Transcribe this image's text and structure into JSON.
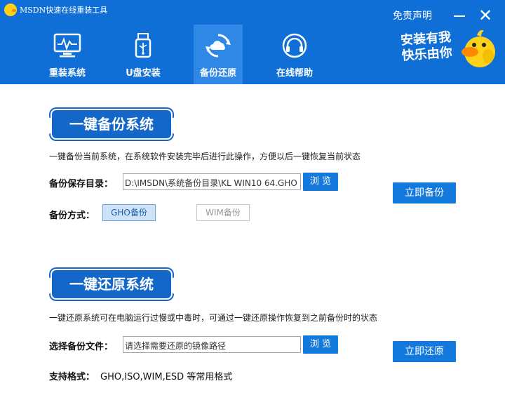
{
  "window": {
    "title": "MSDN快速在线重装工具",
    "disclaimer": "免责声明",
    "minimize_icon": "minimize-icon",
    "close_symbol": "✕"
  },
  "nav": {
    "items": [
      {
        "label": "重装系统",
        "icon": "monitor-icon",
        "active": false
      },
      {
        "label": "U盘安装",
        "icon": "usb-icon",
        "active": false
      },
      {
        "label": "备份还原",
        "icon": "cloud-sync-icon",
        "active": true
      },
      {
        "label": "在线帮助",
        "icon": "headset-icon",
        "active": false
      }
    ]
  },
  "mascot": {
    "line1": "安装有我",
    "line2": "快乐由你"
  },
  "backup": {
    "banner": "一键备份系统",
    "description": "一键备份当前系统，在系统软件安装完毕后进行此操作，方便以后一键恢复当前状态",
    "dir_label": "备份保存目录：",
    "dir_value": "D:\\IMSDN\\系统备份目录\\KL WIN10 64.GHO",
    "browse_label": "浏 览",
    "method_label": "备份方式：",
    "method_gho": "GHO备份",
    "method_wim": "WIM备份",
    "action_label": "立即备份"
  },
  "restore": {
    "banner": "一键还原系统",
    "description": "一键还原系统可在电脑运行过慢或中毒时，可通过一键还原操作恢复到之前备份时的状态",
    "file_label": "选择备份文件：",
    "file_placeholder": "请选择需要还原的镜像路径",
    "browse_label": "浏 览",
    "action_label": "立即还原",
    "formats_label": "支持格式：",
    "formats_value": "GHO,ISO,WIM,ESD 等常用格式"
  },
  "colors": {
    "header_bg": "#0f6fd6",
    "active_tab": "#2f88e6",
    "button": "#1479dc",
    "banner": "#1367c9"
  }
}
